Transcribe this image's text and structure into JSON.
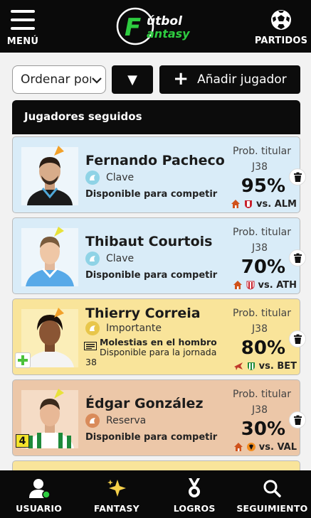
{
  "header": {
    "menu_label": "MENÚ",
    "logo_line1": "útbol",
    "logo_line2": "antasy",
    "logo_initial": "F",
    "partidos_label": "PARTIDOS"
  },
  "controls": {
    "sort_value": "Ordenar por",
    "direction_symbol": "▼",
    "add_label": "Añadir jugador"
  },
  "panel": {
    "title": "Jugadores seguidos"
  },
  "players": [
    {
      "name": "Fernando Pacheco",
      "role": "Clave",
      "status": "Disponible para competir",
      "prob_label": "Prob. titular",
      "jornada": "J38",
      "pct": "95%",
      "match": "vs. ALM",
      "bg": "#d9ecf8",
      "role_color": "#8fd3e6"
    },
    {
      "name": "Thibaut Courtois",
      "role": "Clave",
      "status": "Disponible para competir",
      "prob_label": "Prob. titular",
      "jornada": "J38",
      "pct": "70%",
      "match": "vs. ATH",
      "bg": "#d9ecf8",
      "role_color": "#8fd3e6"
    },
    {
      "name": "Thierry Correia",
      "role": "Importante",
      "status_title": "Molestias en el hombro",
      "status_sub": "Disponible para la jornada 38",
      "prob_label": "Prob. titular",
      "jornada": "J38",
      "pct": "80%",
      "match": "vs. BET",
      "bg": "#f9e49a",
      "role_color": "#e8c64a"
    },
    {
      "name": "Édgar González",
      "role": "Reserva",
      "status": "Disponible para competir",
      "prob_label": "Prob. titular",
      "jornada": "J38",
      "pct": "30%",
      "match": "vs. VAL",
      "badge": "4",
      "bg": "#ecc7a8",
      "role_color": "#d98b5a"
    }
  ],
  "bottom_nav": {
    "usuario": "USUARIO",
    "fantasy": "FANTASY",
    "logros": "LOGROS",
    "seguimiento": "SEGUIMIENTO"
  },
  "colors": {
    "bar": "#0a0a0a",
    "accent_green": "#2ecc40",
    "blue_card": "#d9ecf8",
    "yellow_card": "#f9e49a",
    "orange_card": "#ecc7a8"
  }
}
